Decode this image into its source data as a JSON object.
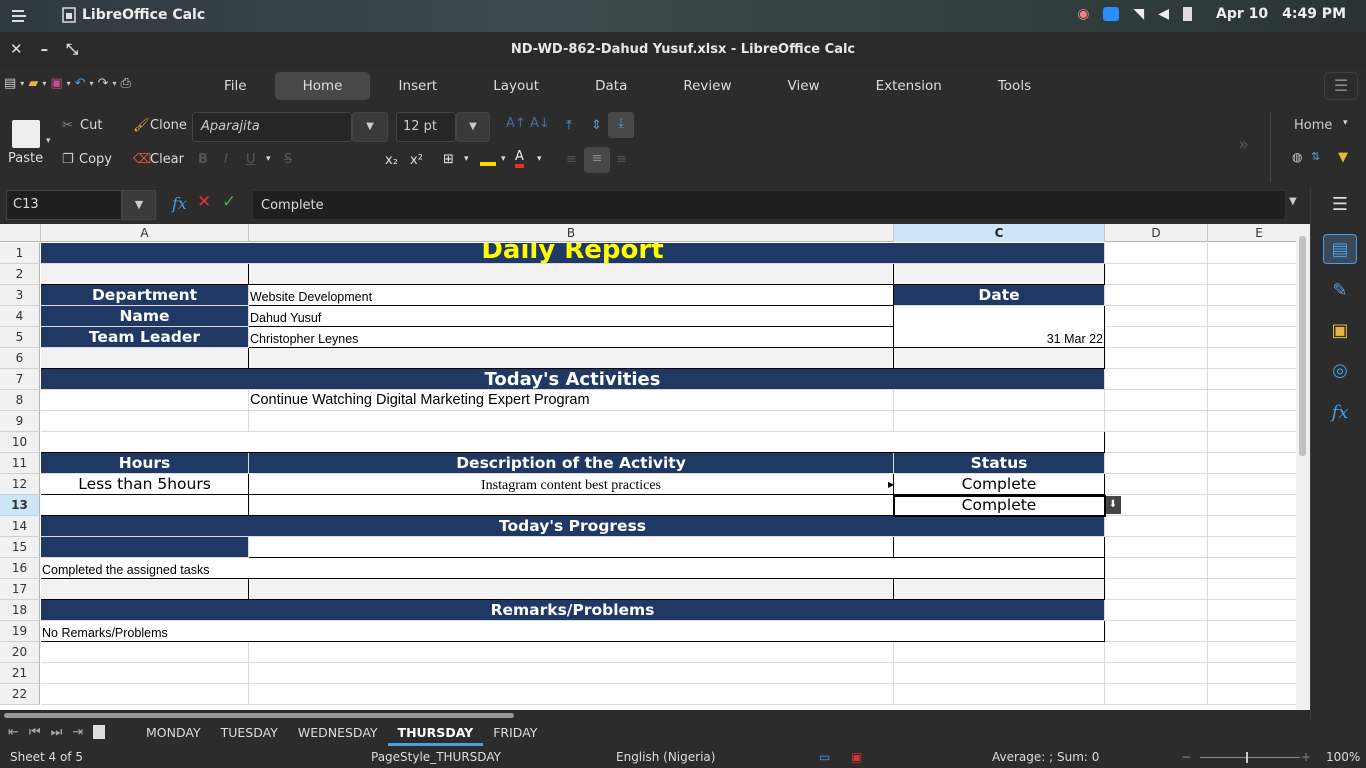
{
  "topbar": {
    "app_name": "LibreOffice Calc",
    "date": "Apr 10",
    "time": "4:49 PM",
    "icons": [
      "activities-icon",
      "app-icon",
      "notification-icon",
      "zoom-icon",
      "wifi-icon",
      "volume-icon",
      "battery-icon"
    ]
  },
  "window": {
    "title": "ND-WD-862-Dahud Yusuf.xlsx - LibreOffice Calc"
  },
  "menu": {
    "tabs": [
      "File",
      "Home",
      "Insert",
      "Layout",
      "Data",
      "Review",
      "View",
      "Extension",
      "Tools"
    ],
    "active": "Home"
  },
  "ribbon": {
    "paste": "Paste",
    "cut": "Cut",
    "copy": "Copy",
    "clone": "Clone",
    "clear": "Clear",
    "font_name": "Aparajita",
    "font_size": "12 pt",
    "subscript": "x₂",
    "superscript": "x²",
    "home_dropdown": "Home"
  },
  "formula_bar": {
    "cell_ref": "C13",
    "content": "Complete",
    "fx": "fx"
  },
  "columns": [
    "A",
    "B",
    "C",
    "D",
    "E"
  ],
  "selected_column": "C",
  "rows": [
    "1",
    "2",
    "3",
    "4",
    "5",
    "6",
    "7",
    "8",
    "9",
    "10",
    "11",
    "12",
    "13",
    "14",
    "15",
    "16",
    "17",
    "18",
    "19",
    "20",
    "21",
    "22"
  ],
  "selected_row": "13",
  "sheet": {
    "title": "Daily Report",
    "department_label": "Department",
    "department_value": "Website Development",
    "date_label": "Date",
    "name_label": "Name",
    "name_value": "Dahud Yusuf",
    "team_leader_label": "Team Leader",
    "team_leader_value": "Christopher Leynes",
    "date_value": "31 Mar 22",
    "activities_header": "Today's Activities",
    "activity_1": "Continue Watching Digital Marketing Expert Program",
    "hours_header": "Hours",
    "description_header": "Description of the Activity",
    "status_header": "Status",
    "hours_value": "Less than 5hours",
    "description_value": "Instagram content best practices",
    "status_1": "Complete",
    "status_2": "Complete",
    "progress_header": "Today's Progress",
    "progress_value": "Completed the assigned tasks",
    "remarks_header": "Remarks/Problems",
    "remarks_value": "No Remarks/Problems"
  },
  "sheet_tabs": [
    "MONDAY",
    "TUESDAY",
    "WEDNESDAY",
    "THURSDAY",
    "FRIDAY"
  ],
  "active_sheet": "THURSDAY",
  "status_bar": {
    "sheet_info": "Sheet 4 of 5",
    "page_style": "PageStyle_THURSDAY",
    "language": "English (Nigeria)",
    "sum": "Average: ; Sum: 0",
    "zoom": "100%"
  },
  "colors": {
    "navy": "#1f3864",
    "title_yellow": "#ffff00",
    "accent": "#4a9fe0"
  }
}
